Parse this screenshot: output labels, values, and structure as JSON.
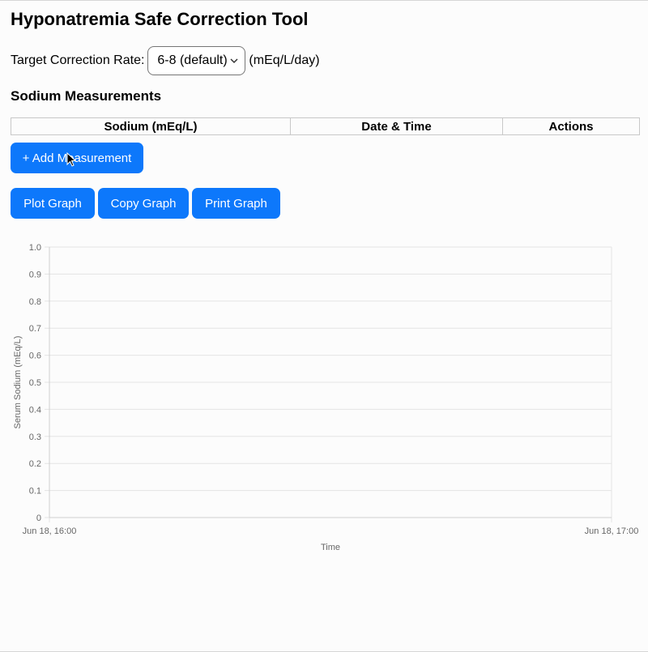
{
  "header": {
    "title": "Hyponatremia Safe Correction Tool"
  },
  "rate": {
    "label": "Target Correction Rate:",
    "selected": "6-8 (default)",
    "unit": "(mEq/L/day)"
  },
  "measurements": {
    "title": "Sodium Measurements",
    "columns": [
      "Sodium (mEq/L)",
      "Date & Time",
      "Actions"
    ],
    "rows": []
  },
  "buttons": {
    "add": "+ Add Measurement",
    "plot": "Plot Graph",
    "copy": "Copy Graph",
    "print": "Print Graph"
  },
  "chart_data": {
    "type": "line",
    "xlabel": "Time",
    "ylabel": "Serum Sodium (mEq/L)",
    "ylim": [
      0,
      1
    ],
    "yticks": [
      "1.0",
      "0.9",
      "0.8",
      "0.7",
      "0.6",
      "0.5",
      "0.4",
      "0.3",
      "0.2",
      "0.1",
      "0"
    ],
    "xticks": [
      "Jun 18, 16:00",
      "Jun 18, 17:00"
    ],
    "grid": true,
    "series": []
  },
  "colors": {
    "accent": "#0d78fb",
    "grid": "#e4e4e4",
    "axis_text": "#666666"
  }
}
